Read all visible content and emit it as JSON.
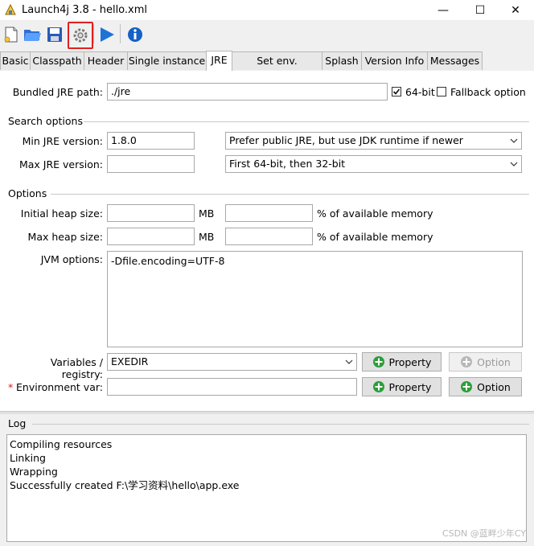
{
  "window": {
    "title": "Launch4j 3.8 - hello.xml",
    "minimize_glyph": "—",
    "maximize_glyph": "☐",
    "close_glyph": "✕"
  },
  "toolbar": {
    "icons": [
      "new-file-icon",
      "open-folder-icon",
      "save-icon",
      "build-wrapper-icon",
      "run-icon",
      "info-icon"
    ],
    "selected_icon": "build-wrapper-icon",
    "highlight_color": "#e02020"
  },
  "tabs": [
    {
      "label": "Basic"
    },
    {
      "label": "Classpath"
    },
    {
      "label": "Header"
    },
    {
      "label": "Single instance"
    },
    {
      "label": "JRE"
    },
    {
      "label": "Set env. variables"
    },
    {
      "label": "Splash"
    },
    {
      "label": "Version Info"
    },
    {
      "label": "Messages"
    }
  ],
  "active_tab": "JRE",
  "jre": {
    "bundled_label": "Bundled JRE path:",
    "bundled_value": "./jre",
    "bit64_label": "64-bit",
    "bit64_checked": true,
    "fallback_label": "Fallback option",
    "fallback_checked": false
  },
  "search_options": {
    "title": "Search options",
    "min_label": "Min JRE version:",
    "min_value": "1.8.0",
    "max_label": "Max JRE version:",
    "max_value": "",
    "jdk_preference": "Prefer public JRE, but use JDK runtime if newer",
    "runtime_bits": "First 64-bit, then 32-bit"
  },
  "options": {
    "title": "Options",
    "initial_heap_label": "Initial heap size:",
    "max_heap_label": "Max heap size:",
    "mb_label": "MB",
    "percent_label": "% of available memory",
    "jvm_label": "JVM options:",
    "jvm_value": "-Dfile.encoding=UTF-8",
    "variables_label": "Variables / registry:",
    "variables_value": "EXEDIR",
    "env_required_mark": "*",
    "env_label": "Environment var:",
    "property_button": "Property",
    "option_button": "Option"
  },
  "log": {
    "title": "Log",
    "lines": [
      "Compiling resources",
      "Linking",
      "Wrapping",
      "Successfully created F:\\学习资料\\hello\\app.exe"
    ]
  },
  "watermark": "CSDN @蓝畔少年CY"
}
